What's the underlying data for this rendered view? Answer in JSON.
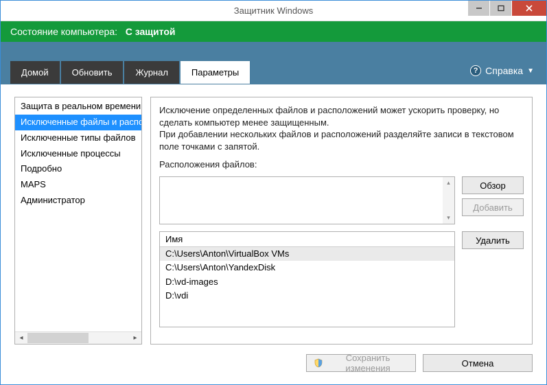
{
  "window": {
    "title": "Защитник Windows"
  },
  "status": {
    "label": "Состояние компьютера:",
    "value": "С защитой"
  },
  "tabs": [
    {
      "label": "Домой"
    },
    {
      "label": "Обновить"
    },
    {
      "label": "Журнал"
    },
    {
      "label": "Параметры"
    }
  ],
  "help": {
    "label": "Справка"
  },
  "sidebar": {
    "items": [
      {
        "label": "Защита в реальном времени"
      },
      {
        "label": "Исключенные файлы и расположения"
      },
      {
        "label": "Исключенные типы файлов"
      },
      {
        "label": "Исключенные процессы"
      },
      {
        "label": "Подробно"
      },
      {
        "label": "MAPS"
      },
      {
        "label": "Администратор"
      }
    ],
    "selected_index": 1
  },
  "detail": {
    "description_line1": "Исключение определенных файлов и расположений может ускорить проверку, но сделать компьютер менее защищенным.",
    "description_line2": "При добавлении нескольких файлов и расположений разделяйте записи в текстовом поле точками с запятой.",
    "locations_label": "Расположения файлов:",
    "locations_value": "",
    "names_header": "Имя",
    "names": [
      "C:\\Users\\Anton\\VirtualBox VMs",
      "C:\\Users\\Anton\\YandexDisk",
      "D:\\vd-images",
      "D:\\vdi"
    ],
    "selected_name_index": 0
  },
  "buttons": {
    "browse": "Обзор",
    "add": "Добавить",
    "remove": "Удалить",
    "save": "Сохранить изменения",
    "cancel": "Отмена"
  }
}
